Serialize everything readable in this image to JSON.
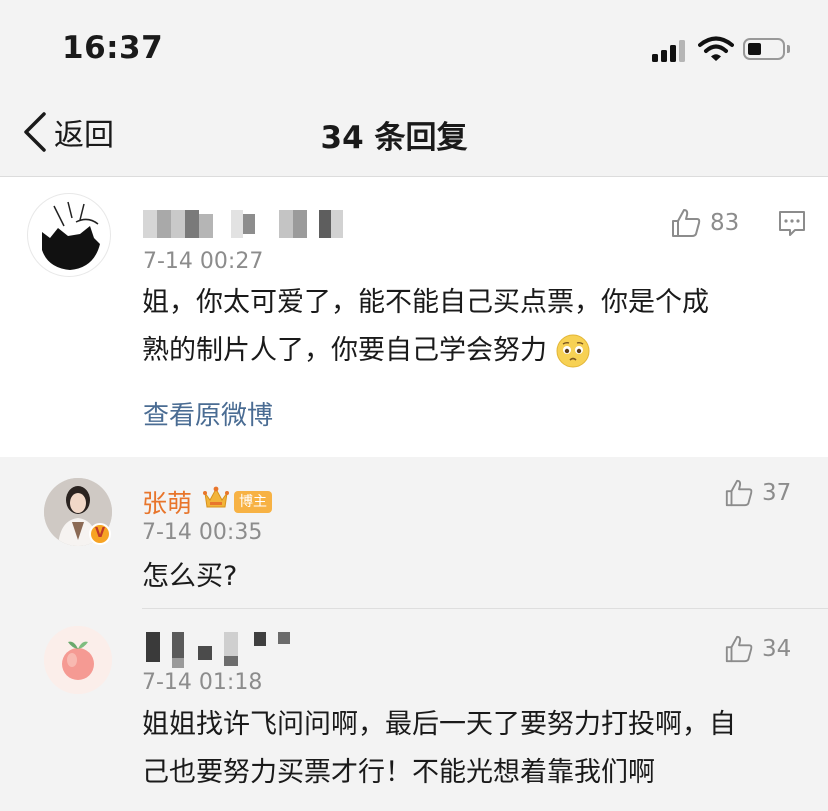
{
  "status_bar": {
    "time": "16:37"
  },
  "nav": {
    "back_label": "返回",
    "title": "34 条回复"
  },
  "main_comment": {
    "timestamp": "7-14 00:27",
    "likes": "83",
    "text_line1": "姐，你太可爱了，能不能自己买点票，你是个成",
    "text_line2": "熟的制片人了，你要自己学会努力",
    "view_original_label": "查看原微博"
  },
  "replies": [
    {
      "name": "张萌",
      "badge": "博主",
      "timestamp": "7-14 00:35",
      "likes": "37",
      "text": "怎么买?"
    },
    {
      "timestamp": "7-14 01:18",
      "likes": "34",
      "text_line1": "姐姐找许飞问问啊，最后一天了要努力打投啊，自",
      "text_line2": "己也要努力买票才行！不能光想着靠我们啊"
    }
  ],
  "colors": {
    "link_blue": "#4a6c93",
    "name_orange": "#e8752b",
    "badge_yellow": "#f7b244",
    "muted_gray": "#8c8c8c"
  },
  "icons": {
    "like": "thumbs-up-icon",
    "comment": "comment-bubble-icon",
    "back": "chevron-left-icon",
    "emoji": "pleading-face-icon",
    "crown": "crown-icon",
    "verified": "verified-v-icon"
  }
}
